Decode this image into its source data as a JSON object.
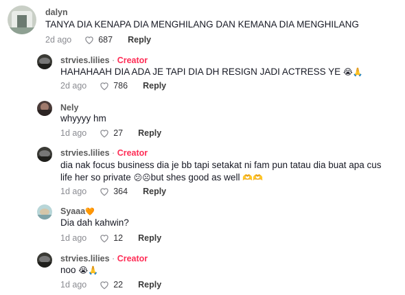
{
  "comments": [
    {
      "username": "dalyn",
      "is_creator": false,
      "text": "TANYA DIA KENAPA DIA MENGHILANG DAN KEMANA DIA MENGHILANG",
      "date": "2d ago",
      "likes": "687",
      "reply_label": "Reply"
    },
    {
      "username": "strvies.lilies",
      "is_creator": true,
      "creator_label": "Creator",
      "text": "HAHAHAAH DIA ADA JE TAPI DIA DH RESIGN JADI ACTRESS YE",
      "emojis": "😭🙏",
      "date": "2d ago",
      "likes": "786",
      "reply_label": "Reply"
    },
    {
      "username": "Nely",
      "is_creator": false,
      "text": "whyyyy hm",
      "date": "1d ago",
      "likes": "27",
      "reply_label": "Reply"
    },
    {
      "username": "strvies.lilies",
      "is_creator": true,
      "creator_label": "Creator",
      "text_line1": "dia nak focus business dia je bb tapi setakat ni fam pun tatau dia buat apa cus",
      "text_line2_a": "life her so private",
      "emojis_mid": "😕☹",
      "text_line2_b": "but shes good as well",
      "emojis_end": "🫶🫶",
      "date": "1d ago",
      "likes": "364",
      "reply_label": "Reply"
    },
    {
      "username": "Syaaa",
      "username_badge": "🧡",
      "is_creator": false,
      "text": "Dia dah kahwin?",
      "date": "1d ago",
      "likes": "12",
      "reply_label": "Reply"
    },
    {
      "username": "strvies.lilies",
      "is_creator": true,
      "creator_label": "Creator",
      "text": "noo",
      "emojis": "😭🙏",
      "date": "1d ago",
      "likes": "22",
      "reply_label": "Reply"
    }
  ],
  "colors": {
    "creator": "#fe2c55",
    "text": "#161823",
    "meta": "#8a8b91"
  },
  "icons": {
    "like": "heart-outline-icon"
  }
}
